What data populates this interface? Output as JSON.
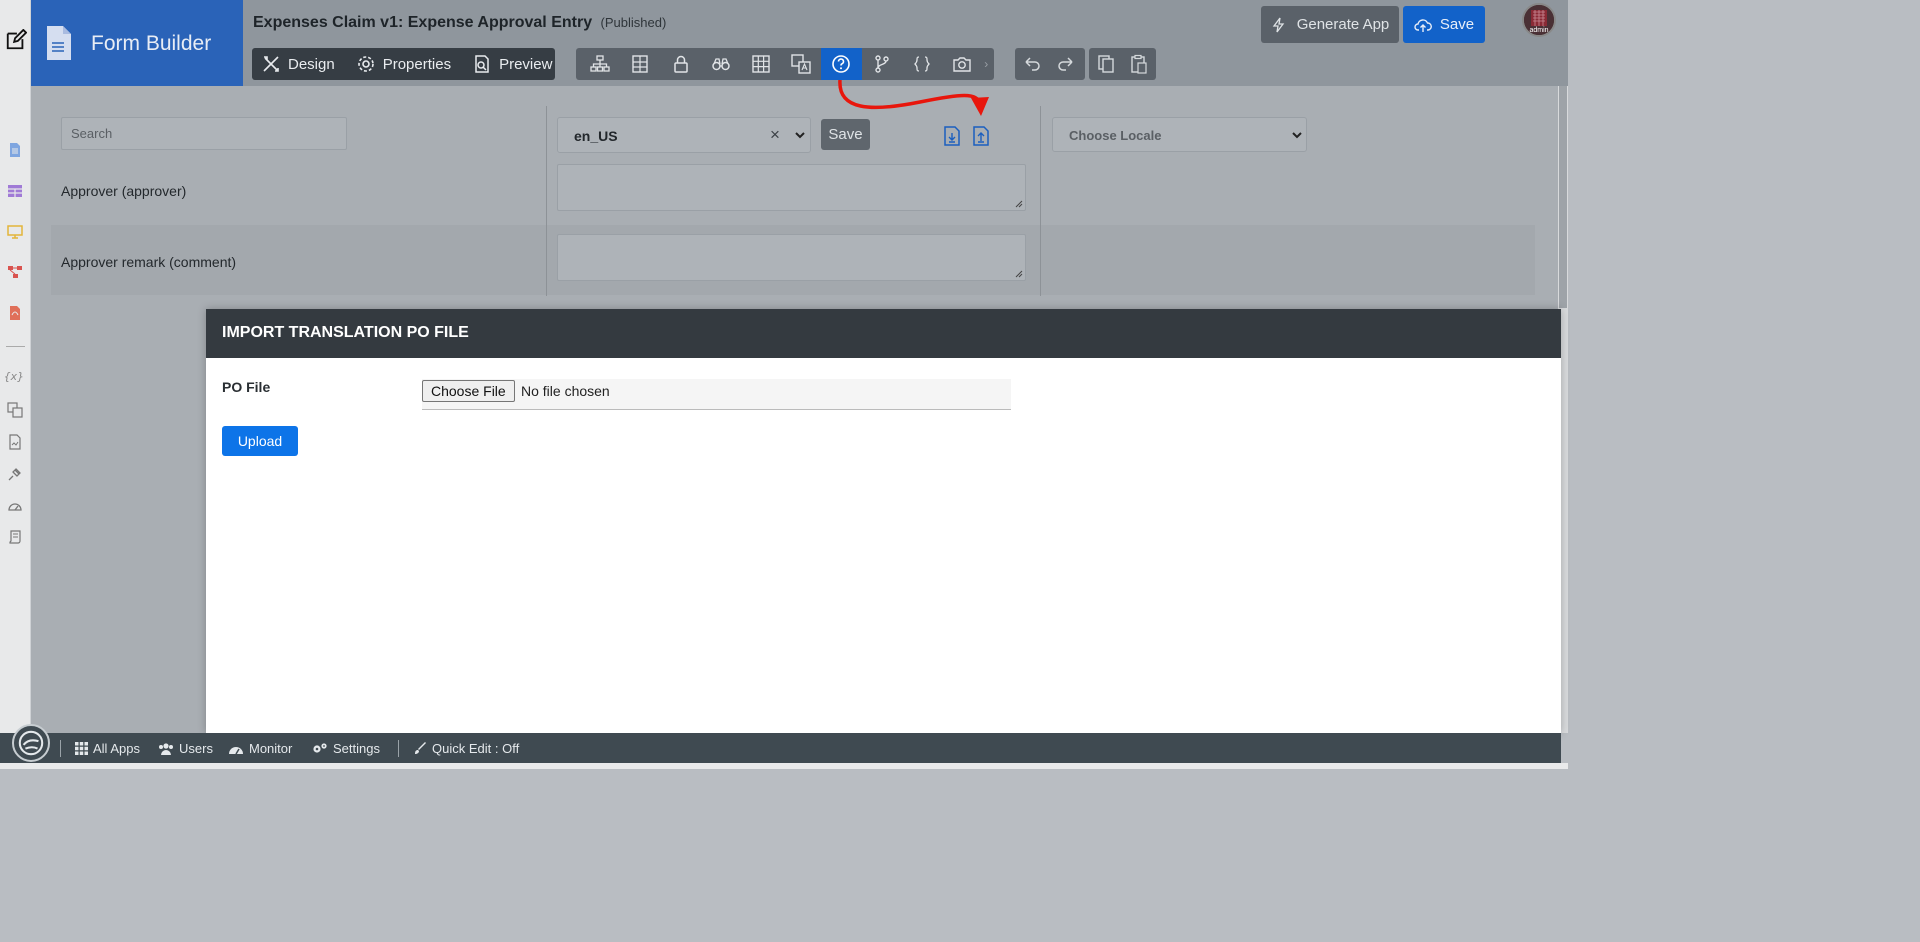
{
  "header": {
    "brand_title": "Form Builder",
    "form_title": "Expenses Claim v1: Expense Approval Entry",
    "form_status": "(Published)",
    "tabs": [
      {
        "label": "Design",
        "icon": "design-tools-icon"
      },
      {
        "label": "Properties",
        "icon": "gear-icon"
      },
      {
        "label": "Preview",
        "icon": "preview-icon"
      }
    ],
    "toolbar_icons": [
      "sitemap-icon",
      "form-table-icon",
      "lock-icon",
      "binoculars-icon",
      "grid-icon",
      "translate-icon",
      "help-circle-icon",
      "branch-icon",
      "braces-icon",
      "camera-icon"
    ],
    "active_tool": "help-circle-icon",
    "generate_app_label": "Generate App",
    "save_label": "Save",
    "avatar_label": "admin"
  },
  "translation": {
    "search_placeholder": "Search",
    "locale_value": "en_US",
    "locale_clear": "×",
    "save_label": "Save",
    "choose_locale_placeholder": "Choose Locale",
    "fields": [
      {
        "label": "Approver (approver)"
      },
      {
        "label": "Approver remark (comment)"
      }
    ]
  },
  "modal": {
    "title": "IMPORT TRANSLATION PO FILE",
    "po_file_label": "PO File",
    "choose_file_label": "Choose File",
    "file_status": "No file chosen",
    "upload_label": "Upload"
  },
  "bottom_bar": {
    "all_apps": "All Apps",
    "users": "Users",
    "monitor": "Monitor",
    "settings": "Settings",
    "quick_edit": "Quick Edit : Off"
  },
  "left_strip": {
    "variable_text": "{x}"
  },
  "colors": {
    "brand": "#2a63b8",
    "primary": "#0d74e8",
    "dark": "#343a40",
    "annotation": "#e8160c"
  }
}
